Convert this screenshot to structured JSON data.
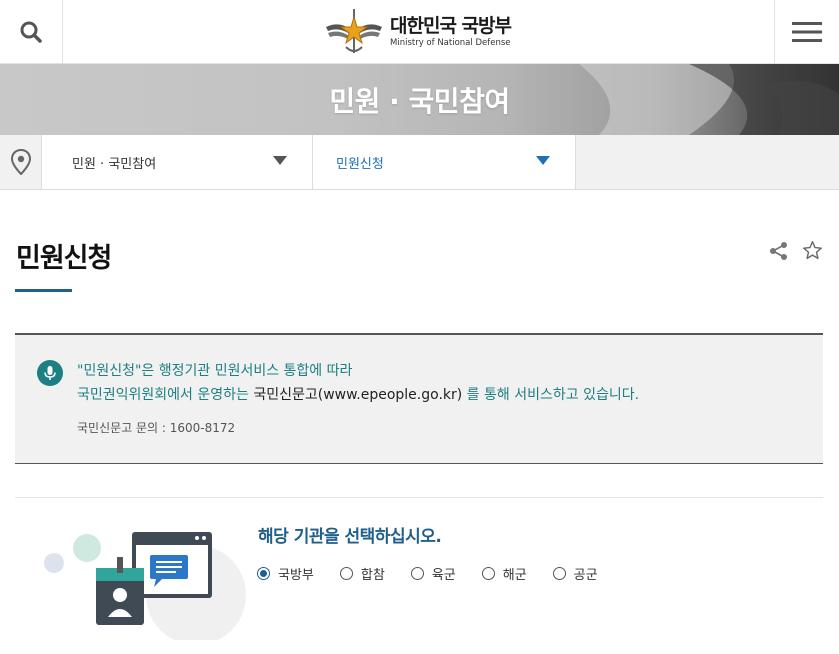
{
  "header": {
    "logo_ko": "대한민국 국방부",
    "logo_en": "Ministry of National Defense",
    "search_icon": "search-icon",
    "menu_icon": "hamburger-menu-icon"
  },
  "banner": {
    "title": "민원 · 국민참여"
  },
  "location": {
    "home_icon": "location-pin-icon",
    "depth1": "민원 · 국민참여",
    "depth2": "민원신청"
  },
  "page": {
    "title": "민원신청",
    "share_icon": "share-icon",
    "favorite_icon": "star-icon"
  },
  "notice": {
    "line1": "\"민원신청\"은 행정기관 민원서비스 통합에 따라",
    "line2_a": "국민권익위원회에서 운영하는 ",
    "line2_b": "국민신문고(www.epeople.go.kr)",
    "line2_c": " 를 통해 서비스하고 있습니다.",
    "contact": "국민신문고 문의 : 1600-8172"
  },
  "agency_select": {
    "title": "해당 기관을 선택하십시오.",
    "options": [
      "국방부",
      "합참",
      "육군",
      "해군",
      "공군"
    ],
    "selected": "국방부"
  },
  "colors": {
    "accent": "#1f5f8c",
    "notice_text": "#1c7f83",
    "link_blue": "#1f6fb5"
  }
}
